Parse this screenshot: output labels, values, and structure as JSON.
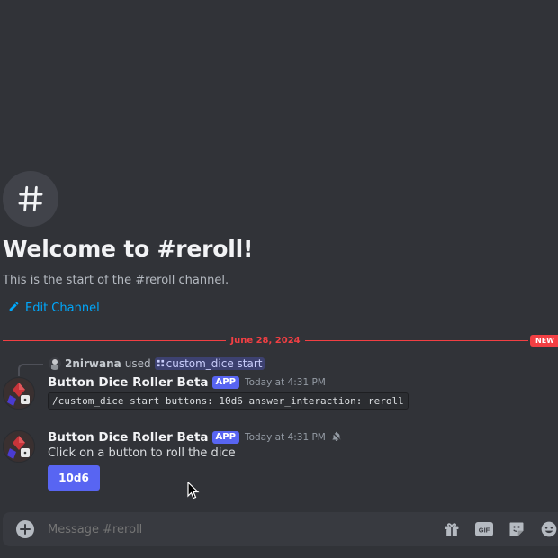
{
  "channel": {
    "hash_symbol": "#",
    "welcome_title": "Welcome to #reroll!",
    "welcome_subtitle": "This is the start of the #reroll channel.",
    "edit_channel_label": "Edit Channel"
  },
  "divider": {
    "date": "June 28, 2024",
    "new_badge": "NEW"
  },
  "messages": [
    {
      "reply": {
        "user": "2nirwana",
        "verb": "used",
        "command": "custom_dice start"
      },
      "username": "Button Dice Roller Beta",
      "tag": "APP",
      "timestamp": "Today at 4:31 PM",
      "code": "/custom_dice start buttons: 10d6 answer_interaction: reroll"
    },
    {
      "username": "Button Dice Roller Beta",
      "tag": "APP",
      "timestamp": "Today at 4:31 PM",
      "text": "Click on a button to roll the dice",
      "button_label": "10d6"
    }
  ],
  "composer": {
    "placeholder": "Message #reroll",
    "icons": [
      "plus-icon",
      "gift-icon",
      "gif-icon",
      "sticker-icon",
      "emoji-icon"
    ]
  },
  "colors": {
    "background": "#313338",
    "accent": "#5865f2",
    "link": "#00a8fc",
    "new_red": "#f23f43"
  }
}
